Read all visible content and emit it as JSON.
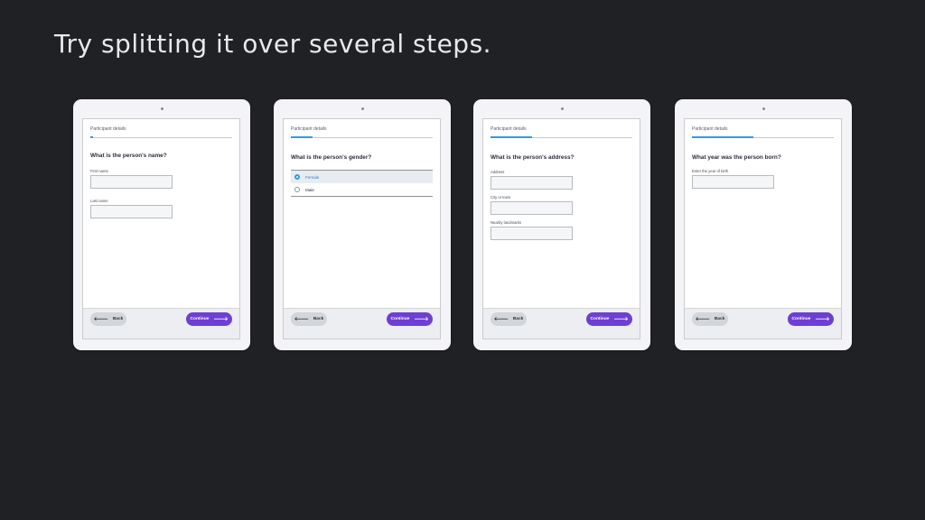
{
  "title": "Try splitting it over several steps.",
  "colors": {
    "background": "#1f2125",
    "progress": "#2e9be8",
    "primary_button": "#6d3fd4"
  },
  "icons": {
    "back": "arrow-left-icon",
    "continue": "arrow-right-icon"
  },
  "tablets": [
    {
      "header": "Participant details",
      "progress": 0.02,
      "question": "What is the person's name?",
      "fields": [
        {
          "label": "First name",
          "value": ""
        },
        {
          "label": "Last name",
          "value": ""
        }
      ],
      "back_label": "Back",
      "continue_label": "Continue"
    },
    {
      "header": "Participant details",
      "progress": 0.15,
      "question": "What is the person's gender?",
      "options": [
        {
          "label": "Female",
          "selected": true
        },
        {
          "label": "Male",
          "selected": false
        }
      ],
      "back_label": "Back",
      "continue_label": "Continue"
    },
    {
      "header": "Participant details",
      "progress": 0.29,
      "question": "What is the person's address?",
      "fields": [
        {
          "label": "Address",
          "value": ""
        },
        {
          "label": "City or town",
          "value": ""
        },
        {
          "label": "Nearby landmarks",
          "value": ""
        }
      ],
      "back_label": "Back",
      "continue_label": "Continue"
    },
    {
      "header": "Participant details",
      "progress": 0.43,
      "question": "What year was the person born?",
      "fields": [
        {
          "label": "Enter the year of birth",
          "value": ""
        }
      ],
      "back_label": "Back",
      "continue_label": "Continue"
    }
  ]
}
